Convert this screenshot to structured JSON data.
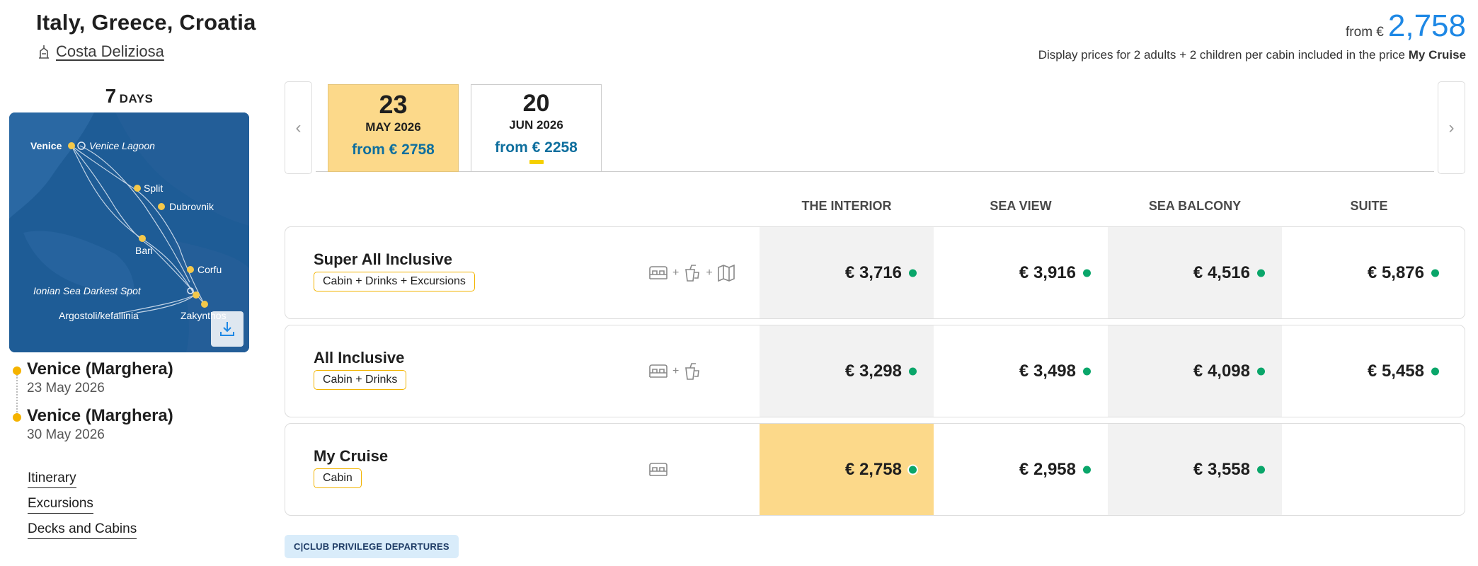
{
  "cruise": {
    "title": "Italy, Greece, Croatia",
    "ship_name": "Costa Deliziosa",
    "from_label": "from €",
    "from_price": "2,758",
    "disclaimer": "Display prices for 2 adults + 2 children per cabin included in the price",
    "disclaimer_bold": "My Cruise"
  },
  "duration": {
    "number": "7",
    "unit": "DAYS"
  },
  "map": {
    "labels": {
      "venice": "Venice",
      "lagoon": "Venice Lagoon",
      "split": "Split",
      "dubrovnik": "Dubrovnik",
      "bari": "Bari",
      "corfu": "Corfu",
      "ionian": "Ionian Sea Darkest Spot",
      "argostoli": "Argostoli/kefallinia",
      "zakynthos": "Zakynthos"
    },
    "download_icon": "download-icon"
  },
  "ports": [
    {
      "name": "Venice (Marghera)",
      "date": "23 May 2026"
    },
    {
      "name": "Venice (Marghera)",
      "date": "30 May 2026"
    }
  ],
  "links": [
    "Itinerary",
    "Excursions",
    "Decks and Cabins"
  ],
  "dates": [
    {
      "day": "23",
      "month": "MAY 2026",
      "from": "from € 2758",
      "active": true
    },
    {
      "day": "20",
      "month": "JUN 2026",
      "from": "from € 2258",
      "active": false
    }
  ],
  "columns": [
    "THE INTERIOR",
    "SEA VIEW",
    "SEA BALCONY",
    "SUITE"
  ],
  "packages": [
    {
      "name": "Super All Inclusive",
      "badge": "Cabin + Drinks + Excursions",
      "icons": [
        "bed-icon",
        "drink-icon",
        "map-icon"
      ],
      "prices": [
        "€ 3,716",
        "€ 3,916",
        "€ 4,516",
        "€ 5,876"
      ]
    },
    {
      "name": "All Inclusive",
      "badge": "Cabin + Drinks",
      "icons": [
        "bed-icon",
        "drink-icon"
      ],
      "prices": [
        "€ 3,298",
        "€ 3,498",
        "€ 4,098",
        "€ 5,458"
      ]
    },
    {
      "name": "My Cruise",
      "badge": "Cabin",
      "icons": [
        "bed-icon"
      ],
      "prices": [
        "€ 2,758",
        "€ 2,958",
        "€ 3,558",
        ""
      ]
    }
  ],
  "club_badge": "C|CLUB PRIVILEGE DEPARTURES",
  "colors": {
    "accent_blue": "#1e88e5",
    "highlight_yellow": "#fcd98a",
    "available_green": "#0aa66a",
    "badge_border": "#f2b400"
  }
}
